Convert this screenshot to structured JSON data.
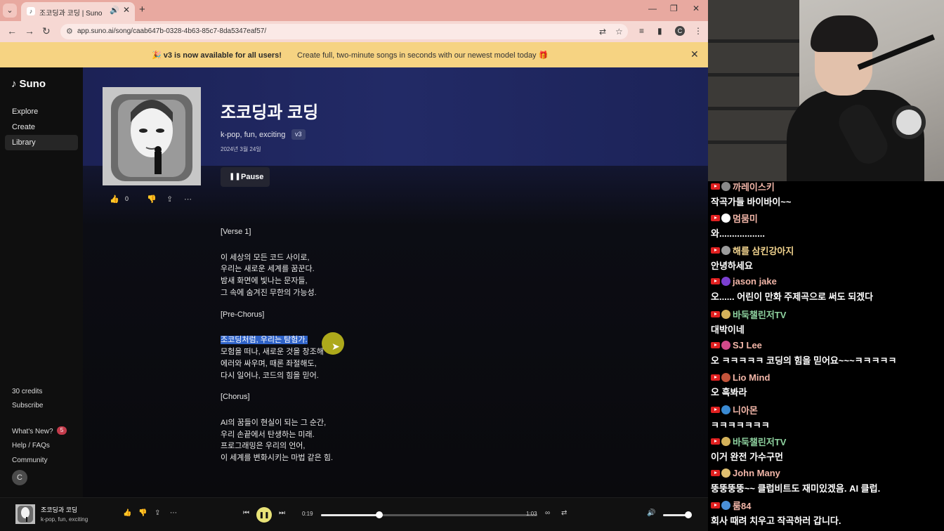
{
  "browser": {
    "tab_title": "조코딩과 코딩 | Suno",
    "url": "app.suno.ai/song/caab647b-0328-4b63-85c7-8da5347eaf57/",
    "profile_initial": "C"
  },
  "banner": {
    "title": "v3 is now available for all users!",
    "text": "Create full, two-minute songs in seconds with our newest model today"
  },
  "sidebar": {
    "logo": "Suno",
    "nav": [
      {
        "label": "Explore"
      },
      {
        "label": "Create"
      },
      {
        "label": "Library",
        "active": true
      }
    ],
    "credits": "30 credits",
    "subscribe": "Subscribe",
    "whats_new": "What's New?",
    "whats_new_badge": "5",
    "help": "Help / FAQs",
    "community": "Community",
    "avatar_initial": "C"
  },
  "song": {
    "title": "조코딩과 코딩",
    "tags": "k-pop, fun, exciting",
    "version": "v3",
    "date": "2024년 3월 24일",
    "pause_label": "Pause",
    "like_count": "0"
  },
  "lyrics": [
    "[Verse 1]",
    "",
    "이 세상의 모든 코드 사이로,",
    "우리는 새로운 세계를 꿈꾼다.",
    "밤새 화면에 빛나는 문자들,",
    "그 속에 숨겨진 무한의 가능성.",
    "",
    "[Pre-Chorus]",
    "",
    "조코딩처럼, 우리는 탐험가.",
    "모험을 떠나, 새로운 것을 창조해",
    "에러와 싸우며, 때론 좌절해도,",
    "다시 일어나, 코드의 힘을 믿어.",
    "",
    "[Chorus]",
    "",
    "AI의 꿈들이 현실이 되는 그 순간,",
    "우리 손끝에서 탄생하는 미래.",
    "프로그래밍은 우리의 언어,",
    "이 세계를 변화시키는 마법 같은 힘."
  ],
  "lyrics_highlight_index": 9,
  "player": {
    "title": "조코딩과 코딩",
    "tags": "k-pop, fun, exciting",
    "current_time": "0:19",
    "duration": "1:03",
    "progress_fraction": 0.27,
    "volume_fraction": 0.9
  },
  "chat": [
    {
      "name": "까레이스키",
      "text": "작곡가들 바이바이~~",
      "name_color": "#f2b6a8",
      "avatar_color": "#8a8a8a"
    },
    {
      "name": "멈뭄미",
      "text": "와..................",
      "name_color": "#f2b6a8",
      "avatar_color": "#ffffff"
    },
    {
      "name": "해를 삼킨강아지",
      "text": "안녕하세요",
      "name_color": "#f1d38e",
      "avatar_color": "#9c9c9c"
    },
    {
      "name": "jason jake",
      "text": "오...... 어린이 만화 주제곡으로 써도 되겠다",
      "name_color": "#f2b6a8",
      "avatar_color": "#7b3fd1"
    },
    {
      "name": "바둑챌린저TV",
      "text": "대박이네",
      "name_color": "#8fd3a0",
      "avatar_color": "#d4b25a"
    },
    {
      "name": "SJ Lee",
      "text": "오 ㅋㅋㅋㅋㅋ 코딩의 힘을 믿어요~~~ㅋㅋㅋㅋㅋ",
      "name_color": "#f2b6a8",
      "avatar_color": "#d24a8a"
    },
    {
      "name": "Lio Mind",
      "text": "오 흑봐라",
      "name_color": "#f2b6a8",
      "avatar_color": "#c2533a"
    },
    {
      "name": "니아몬",
      "text": "ㅋㅋㅋㅋㅋㅋㅋ",
      "name_color": "#f2b6a8",
      "avatar_color": "#3a8ad2"
    },
    {
      "name": "바둑챌린저TV",
      "text": "이거 완전 가수구먼",
      "name_color": "#8fd3a0",
      "avatar_color": "#d4b25a"
    },
    {
      "name": "John Many",
      "text": "뚱뚱뚱뚱~~ 클럽비트도 재미있겠음. AI 클럽.",
      "name_color": "#f2b6a8",
      "avatar_color": "#e0c070"
    },
    {
      "name": "룸84",
      "text": "회사 때려 치우고 작곡하러 갑니다.",
      "name_color": "#f2b6a8",
      "avatar_color": "#4a90d8"
    }
  ],
  "colors": {
    "accent_highlight": "#2f63c8",
    "play_button": "#e8e277",
    "banner_bg": "#f6d382",
    "hero_bg": "#222a66"
  }
}
